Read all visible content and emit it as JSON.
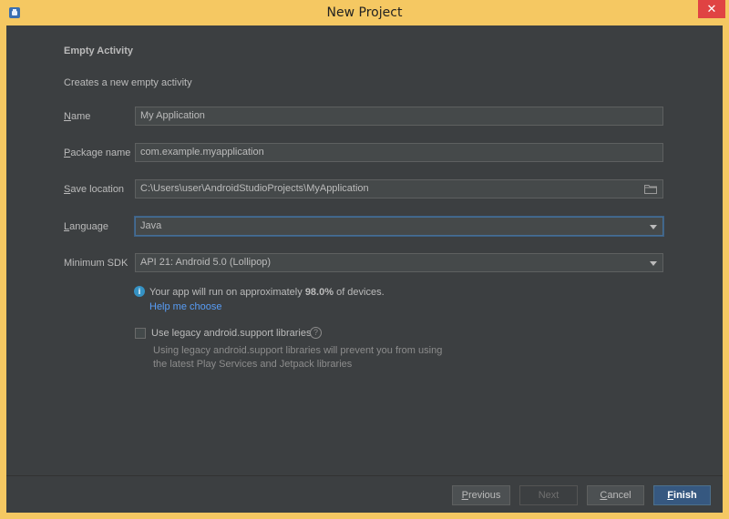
{
  "window": {
    "title": "New Project",
    "close_glyph": "✕",
    "app_icon": "android-studio-icon"
  },
  "form": {
    "header_title": "Empty Activity",
    "subtitle": "Creates a new empty activity",
    "name": {
      "mnemonic": "N",
      "label_rest": "ame",
      "value": "My Application"
    },
    "package": {
      "mnemonic": "P",
      "label_rest": "ackage name",
      "value": "com.example.myapplication"
    },
    "save_location": {
      "mnemonic": "S",
      "label_rest": "ave location",
      "value": "C:\\Users\\user\\AndroidStudioProjects\\MyApplication",
      "icon": "folder-icon"
    },
    "language": {
      "mnemonic": "L",
      "label_rest": "anguage",
      "value": "Java"
    },
    "min_sdk": {
      "label": "Minimum SDK",
      "value": "API 21: Android 5.0 (Lollipop)"
    },
    "info": {
      "icon_glyph": "i",
      "text_before": "Your app will run on approximately ",
      "percent": "98.0%",
      "text_after": " of devices.",
      "help_link": "Help me choose"
    },
    "legacy": {
      "checked": false,
      "label": "Use legacy android.support libraries",
      "help_glyph": "?",
      "description_line1": "Using legacy android.support libraries will prevent you from using",
      "description_line2": "the latest Play Services and Jetpack libraries"
    }
  },
  "footer": {
    "previous": {
      "mnemonic": "P",
      "rest": "revious"
    },
    "next": "Next",
    "cancel": {
      "mnemonic": "C",
      "rest": "ancel"
    },
    "finish": {
      "mnemonic": "F",
      "rest": "inish"
    }
  },
  "colors": {
    "window_frame": "#f5c862",
    "panel_bg": "#3c3f41",
    "field_bg": "#45494a",
    "accent_blue": "#365880",
    "link": "#589df6",
    "close_red": "#e04343"
  }
}
